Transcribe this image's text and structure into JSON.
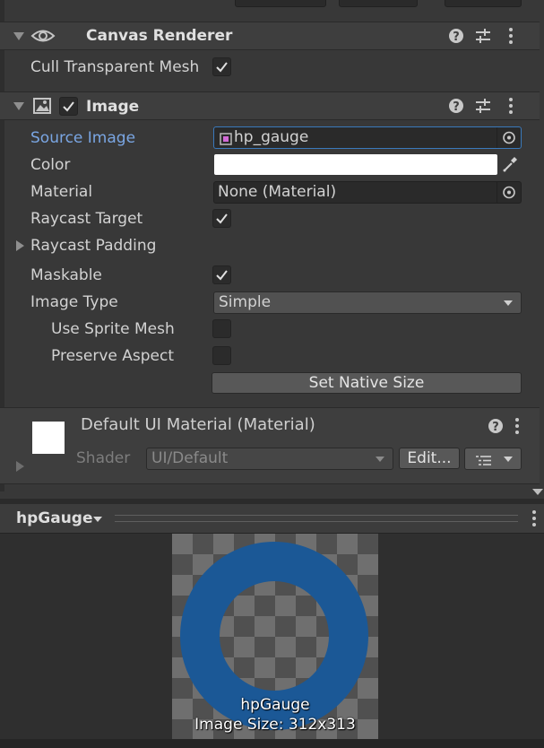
{
  "canvas_renderer": {
    "title": "Canvas Renderer",
    "cull_label": "Cull Transparent Mesh",
    "cull_checked": true
  },
  "image": {
    "title": "Image",
    "enabled": true,
    "source_image_label": "Source Image",
    "source_image_value": "hp_gauge",
    "color_label": "Color",
    "color_value": "#ffffff",
    "material_label": "Material",
    "material_value": "None (Material)",
    "raycast_target_label": "Raycast Target",
    "raycast_target_checked": true,
    "raycast_padding_label": "Raycast Padding",
    "maskable_label": "Maskable",
    "maskable_checked": true,
    "image_type_label": "Image Type",
    "image_type_value": "Simple",
    "use_sprite_mesh_label": "Use Sprite Mesh",
    "use_sprite_mesh_checked": false,
    "preserve_aspect_label": "Preserve Aspect",
    "preserve_aspect_checked": false,
    "set_native_size_label": "Set Native Size"
  },
  "material": {
    "title": "Default UI Material (Material)",
    "shader_label": "Shader",
    "shader_value": "UI/Default",
    "edit_label": "Edit..."
  },
  "preview": {
    "dropdown_label": "hpGauge",
    "name": "hpGauge",
    "size_text": "Image Size: 312x313",
    "ring_color": "#1b5896"
  },
  "colors": {
    "accent": "#7aa6e3",
    "field_focus": "#3a79bb"
  }
}
